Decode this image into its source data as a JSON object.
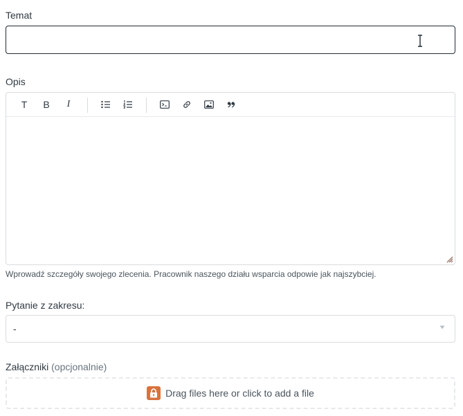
{
  "subject": {
    "label": "Temat",
    "value": ""
  },
  "description": {
    "label": "Opis",
    "toolbar": {
      "text_style": "T",
      "bold": "B",
      "italic": "I"
    },
    "hint": "Wprowadź szczegóły swojego zlecenia. Pracownik naszego działu wsparcia odpowie jak najszybciej."
  },
  "question_scope": {
    "label": "Pytanie z zakresu:",
    "selected": "-"
  },
  "attachments": {
    "label": "Załączniki",
    "optional": "(opcjonalnie)",
    "dropzone_text": "Drag files here or click to add a file"
  },
  "colors": {
    "accent_lock": "#d9733b",
    "border": "#d8dcde",
    "text": "#2f3941"
  }
}
